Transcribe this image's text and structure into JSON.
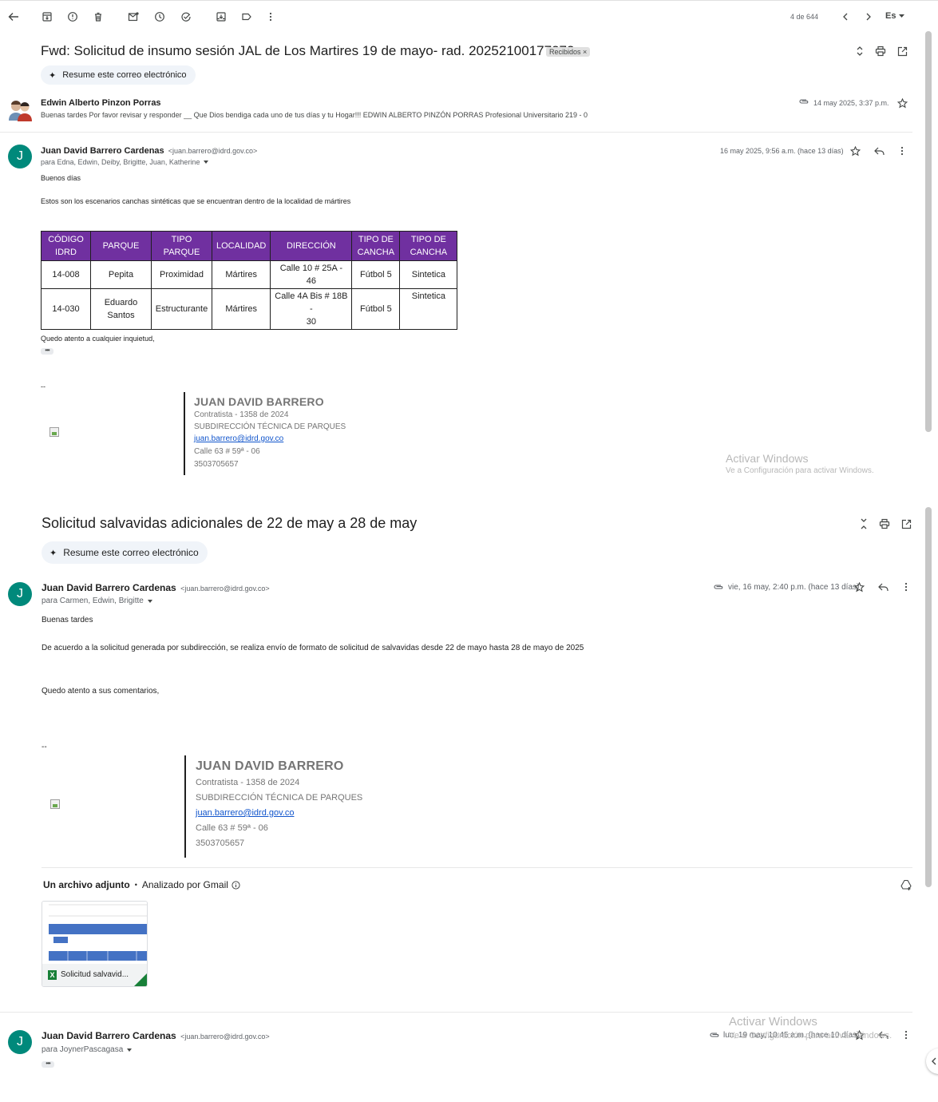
{
  "toolbar": {
    "counter": "4 de 644",
    "input_language": "Es"
  },
  "thread1": {
    "subject": "Fwd: Solicitud de insumo sesión JAL de Los Martires 19 de mayo- rad. 20252100177272",
    "label": "Recibidos",
    "label_close": "×",
    "summarize": "Resume este correo electrónico",
    "msg1": {
      "sender": "Edwin Alberto Pinzon Porras",
      "snippet": "Buenas tardes Por favor revisar y responder __ Que Dios bendiga cada uno de tus días y tu Hogar!!! EDWIN ALBERTO PINZÓN PORRAS Profesional Universitario 219 - 0",
      "date": "14 may 2025, 3:37 p.m."
    },
    "msg2": {
      "avatar": "J",
      "sender": "Juan David Barrero Cardenas",
      "email": "<juan.barrero@idrd.gov.co>",
      "recipients": "para Edna, Edwin, Deiby, Brigitte, Juan, Katherine",
      "date": "16 may 2025, 9:56 a.m. (hace 13 días)",
      "greeting": "Buenos días",
      "intro": "Estos son los escenarios canchas sintéticas que se encuentran dentro de la localidad de mártires",
      "table": {
        "headers": [
          [
            "CÓDIGO",
            "IDRD"
          ],
          [
            "PARQUE"
          ],
          [
            "TIPO",
            "PARQUE"
          ],
          [
            "LOCALIDAD"
          ],
          [
            "DIRECCIÓN"
          ],
          [
            "TIPO DE",
            "CANCHA"
          ],
          [
            "TIPO DE",
            "CANCHA"
          ]
        ],
        "rows": [
          {
            "code": "14-008",
            "park": "Pepita",
            "park_type": "Proximidad",
            "locality": "Mártires",
            "address": "Calle 10 # 25A - 46",
            "field_type": "Fútbol 5",
            "field_kind": "Sintetica"
          },
          {
            "code": "14-030",
            "park_l1": "Eduardo",
            "park_l2": "Santos",
            "park_type": "Estructurante",
            "locality": "Mártires",
            "address_l1": "Calle 4A Bis # 18B -",
            "address_l2": "30",
            "field_type": "Fútbol 5",
            "field_kind": "Sintetica"
          }
        ]
      },
      "closing": "Quedo atento a cualquier inquietud,",
      "sig_dash": "--",
      "signature": {
        "name": "JUAN DAVID BARRERO",
        "line1": "Contratista - 1358 de 2024",
        "line2": "SUBDIRECCIÓN TÉCNICA DE PARQUES",
        "email": "juan.barrero@idrd.gov.co",
        "address": "Calle 63 # 59ª - 06",
        "phone": "3503705657"
      }
    },
    "watermark": {
      "title": "Activar Windows",
      "sub": "Ve a Configuración para activar Windows."
    }
  },
  "thread2": {
    "subject": "Solicitud salvavidas adicionales de 22 de may a 28 de may",
    "summarize": "Resume este correo electrónico",
    "msg1": {
      "avatar": "J",
      "sender": "Juan David Barrero Cardenas",
      "email": "<juan.barrero@idrd.gov.co>",
      "recipients": "para Carmen, Edwin, Brigitte",
      "date": "vie, 16 may, 2:40 p.m. (hace 13 días)",
      "greeting": "Buenas tardes",
      "body": "De acuerdo a la solicitud generada por subdirección, se realiza envío de formato de solicitud de salvavidas desde 22 de mayo hasta 28 de mayo de 2025",
      "closing": "Quedo atento a sus comentarios,",
      "sig_dash": "--",
      "signature": {
        "name": "JUAN DAVID BARRERO",
        "line1": "Contratista - 1358 de 2024",
        "line2": "SUBDIRECCIÓN TÉCNICA DE PARQUES",
        "email": "juan.barrero@idrd.gov.co",
        "address": "Calle 63 # 59ª - 06",
        "phone": "3503705657"
      }
    },
    "attachments": {
      "heading": "Un archivo adjunto",
      "separator": "•",
      "scanned": "Analizado por Gmail",
      "file_name": "Solicitud salvavid...",
      "file_icon": "X"
    },
    "msg2": {
      "avatar": "J",
      "sender": "Juan David Barrero Cardenas",
      "email": "<juan.barrero@idrd.gov.co>",
      "recipients": "para JoynerPascagasa",
      "date": "lun, 19 may, 10:45 a.m. (hace 10 días)"
    },
    "watermark": {
      "title": "Activar Windows",
      "sub": "Ve a Configuración para activar Windows."
    }
  }
}
